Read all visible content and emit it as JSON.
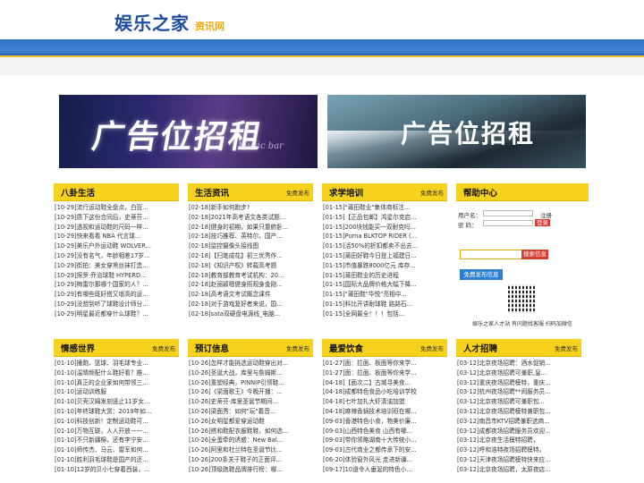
{
  "header": {
    "logo_main": "娱乐之家",
    "logo_sub": "资讯网"
  },
  "ads": [
    {
      "text": "广告位招租",
      "caption": "Music bar"
    },
    {
      "text": "广告位招租"
    }
  ],
  "sections_row1": [
    {
      "title": "八卦生活",
      "items": [
        "[10-29]流行运动鞋全盘点，白百...",
        "[10-29]质下这份合同后，史蒂芬...",
        "[10-29]透视和运动鞋的尺码一样...",
        "[10-29]快来看看 NBA 代言球...",
        "[10-29]美乐户外运动鞋 WOLVER...",
        "[10-29]没有名气，年龄相差17岁...",
        "[10-29]街拍：美女穿黑丝袜打造...",
        "[10-29]探罗·乔治球鞋 HYPERD...",
        "[10-29]梅雷尔那哪个国家的人？...",
        "[10-29]有哪些既好搭又增高的运...",
        "[10-29]没想到听了球鞋设计师分...",
        "[10-29]明星最近都穿什么球鞋？..."
      ]
    },
    {
      "title": "生活资讯",
      "more": "免费发布",
      "items": [
        "[02-18]新手如何跑步?",
        "[02-18]2021年高考语文各类试题...",
        "[02-18]健身的初期，如果只靠俯卧...",
        "[02-18]技巧推荐、英特尔，国产...",
        "[02-18]监控摄像头接线图",
        "[02-18]【扫笔成花】初三优秀作...",
        "[02-18]《知识产权》转载高考题",
        "[02-18]教育部教育考试机构：20...",
        "[02-18]赵丽颖嗯健身照观身金刚...",
        "[02-18]高考语文考试概念课件",
        "[02-18]对于游戏复好者来说，国...",
        "[02-18]sata双硬盘电源线_电脑..."
      ]
    },
    {
      "title": "求学培训",
      "more": "免费发布",
      "items": [
        "[01-15]\"莆田鞋业\"集体商标注...",
        "[01-15]【正品包邮】鸿星尔克启...",
        "[01-15]200块钱能买一双耐克吗...",
        "[01-15]Puma BLKTOP RIDER (...",
        "[01-15]活50%的折扣都卖不出去...",
        "[01-15]莆田好鞋今日登上福建日...",
        "[01-15]市值暴跌8000亿元 库存...",
        "[01-15]莆田鞋业的历史进程",
        "[01-15]国际大品牌价格大幅下降...",
        "[01-15]\"莆田鞋\"华悦\"亮相中...",
        "[01-15]科比开讲耐球鞋 路路石...",
        "[01-15]全网最全！！！包括..."
      ]
    }
  ],
  "help": {
    "title": "帮助中心",
    "user_label": "用户名：",
    "pass_label": "密  码：",
    "register": "注册",
    "login": "登录",
    "search_btn": "搜索信息",
    "publish_btn": "免费发布信息",
    "qr_caption": "娱乐之家人才站 有问题找客服 扫码加微信"
  },
  "sections_row2": [
    {
      "title": "情感世界",
      "more": "免费发布",
      "items": [
        "[01-10]撞跑、篮球、羽毛球专业...",
        "[01-10]温晴频配什么鞋好看？推...",
        "[01-10]真正的企业家如何带领三...",
        "[01-10]运动训练服",
        "[01-10]贝壳汉姆发刻竖止11岁女...",
        "[01-10]年终球鞋大赏：2019年如...",
        "[01-10]科技创新！定制运动鞋可...",
        "[01-10]万物互联，人人开放——...",
        "[01-10]不只新疆棉，还有李宁安...",
        "[01-10]师传杰、马云、雷军如何...",
        "[01-10]胜利羽毛球鞋是国产的还...",
        "[01-10]12岁的贝小七穿着西装，..."
      ]
    },
    {
      "title": "预订信息",
      "more": "免费发布",
      "items": [
        "[10-26]怎样才能挑选运动鞋穿出对...",
        "[10-26]圣诞大战，库里与詹姆斯...",
        "[10-26]重塑经典，PINNIP引领鞋...",
        "[10-26]《梁面歌王》今晚开播：...",
        "[10-26]史蒂芬·库里圣诞节期间...",
        "[10-26]梁面秀：如何\"玩\"着音...",
        "[10-26]女明星都爱穿运动鞋",
        "[10-26]搭和鞋配衣服鞋鞋，如何选...",
        "[10-26]全蛋牵的诱惑：New Bal...",
        "[10-26]阿里和杜兰特在圣诞节比...",
        "[10-26]200条关于鞋子的正面评...",
        "[10-26]顶级跑鞋品牌排行榜：哪..."
      ]
    },
    {
      "title": "最爱饮食",
      "more": "免费发布",
      "items": [
        "[01-27]面：拉面、板面等你来学...",
        "[01-27]面：拉面、板面等你来学...",
        "[04-18]【面次二】古城寻美食...",
        "[04-18]成都特色食品小吃培训学校",
        "[04-18]七叶加扎大虾清油加盟",
        "[04-18]麻辣香锅技术培训班在哪...",
        "[09-03]香港特色小食，物美价廉...",
        "[09-03]山西特色美食 山西有哪...",
        "[09-03]带你领略湖南十大传统小...",
        "[09-03]古代商业之都传承下的安...",
        "[06-20]体验窗外风光 走进新疆...",
        "[09-17]10道令人垂涎的特色小..."
      ]
    },
    {
      "title": "人才招聘",
      "more": "免费发布",
      "items": [
        "[03-12]北京夜场招聘：酒水促销...",
        "[03-12]北京夜场招聘可兼职,皇...",
        "[03-12]重庆夜场招聘模特，重庆...",
        "[03-12]杭州夜场招聘**闹服务员...",
        "[03-12]北京夜场招聘可兼职包...",
        "[03-12]北京夜场招聘模特兼职包...",
        "[03-12]南昌市KTV招聘兼职选商...",
        "[03-12]成都夜场招聘服务员欢迎...",
        "[03-12]北京夜生活模特招聘，",
        "[03-12]呼和浩特夜场招聘模特，",
        "[03-12]天津夜场招聘模特快来应...",
        "[03-12]北京夜场招聘，太原夜店..."
      ]
    }
  ]
}
